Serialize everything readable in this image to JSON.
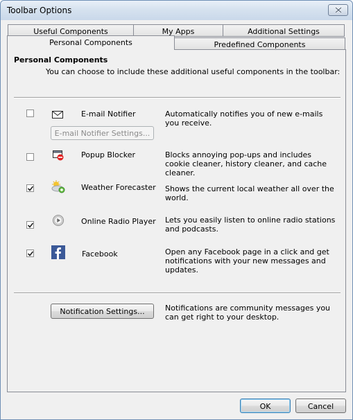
{
  "window": {
    "title": "Toolbar Options"
  },
  "tabs": {
    "row1": [
      "Useful Components",
      "My Apps",
      "Additional Settings"
    ],
    "row2": [
      "Personal Components",
      "Predefined Components"
    ]
  },
  "section": {
    "title": "Personal Components",
    "subtitle": "You can choose to include these additional useful components in the toolbar:"
  },
  "components": [
    {
      "name": "E-mail Notifier",
      "icon": "envelope-icon",
      "checked": false,
      "description": "Automatically notifies you of new e-mails you receive.",
      "settings_button": "E-mail Notifier Settings..."
    },
    {
      "name": "Popup Blocker",
      "icon": "popup-blocker-icon",
      "checked": false,
      "description": "Blocks annoying pop-ups and includes cookie cleaner, history cleaner, and cache cleaner."
    },
    {
      "name": "Weather Forecaster",
      "icon": "weather-icon",
      "checked": true,
      "description": "Shows the current local weather all over the world."
    },
    {
      "name": "Online Radio Player",
      "icon": "radio-play-icon",
      "checked": true,
      "description": "Lets you easily listen to online radio stations and podcasts."
    },
    {
      "name": "Facebook",
      "icon": "facebook-icon",
      "checked": true,
      "description": "Open any Facebook page in a click and get notifications with your new messages and updates."
    }
  ],
  "notifications": {
    "button": "Notification Settings...",
    "description": "Notifications are community messages you can get right to your desktop."
  },
  "footer": {
    "ok": "OK",
    "cancel": "Cancel"
  }
}
